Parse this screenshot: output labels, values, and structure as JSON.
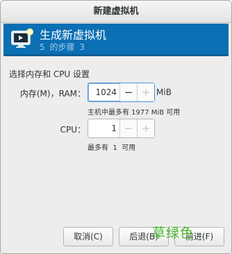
{
  "window": {
    "title": "新建虚拟机"
  },
  "banner": {
    "title": "生成新虚拟机",
    "step_current": "5",
    "step_of": "的步骤",
    "step_total": "3",
    "icon": "monitor-with-star-icon"
  },
  "content": {
    "section_label": "选择内存和 CPU 设置",
    "memory": {
      "label": "内存(M)，RAM：",
      "value": "1024",
      "unit": "MiB",
      "hint": "主机中最多有 1977 MiB 可用",
      "decrement": "−",
      "increment": "+"
    },
    "cpu": {
      "label": "CPU：",
      "value": "1",
      "hint": "最多有  1  可用",
      "decrement": "−",
      "increment": "+"
    }
  },
  "footer": {
    "cancel": "取消(C)",
    "back": "后退(B)",
    "forward": "前进(F)"
  },
  "watermark": "草绿色",
  "colors": {
    "banner": "#0a6fb3",
    "watermark": "#3bb51a"
  }
}
